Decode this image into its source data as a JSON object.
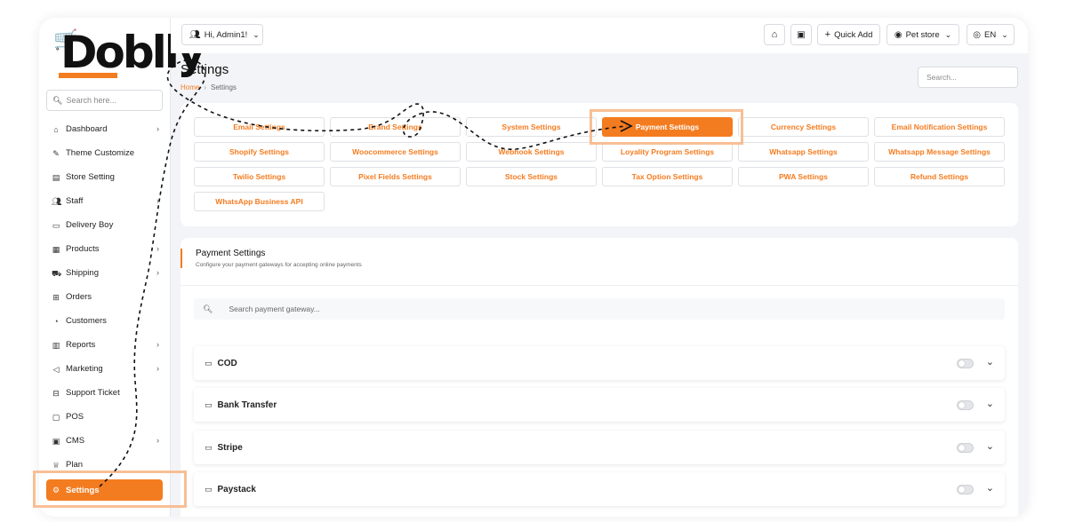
{
  "brand": {
    "name": "Doblly",
    "accent": "#f47c20"
  },
  "sidebar": {
    "search_placeholder": "Search here...",
    "items": [
      {
        "label": "Dashboard",
        "icon": "home-icon",
        "chevron": true
      },
      {
        "label": "Theme Customize",
        "icon": "brush-icon",
        "chevron": false
      },
      {
        "label": "Store Setting",
        "icon": "store-icon",
        "chevron": false
      },
      {
        "label": "Staff",
        "icon": "users-icon",
        "chevron": true
      },
      {
        "label": "Delivery Boy",
        "icon": "truck-icon",
        "chevron": false
      },
      {
        "label": "Products",
        "icon": "box-icon",
        "chevron": true
      },
      {
        "label": "Shipping",
        "icon": "shipping-icon",
        "chevron": true
      },
      {
        "label": "Orders",
        "icon": "cart-icon",
        "chevron": false
      },
      {
        "label": "Customers",
        "icon": "user-icon",
        "chevron": false
      },
      {
        "label": "Reports",
        "icon": "chart-icon",
        "chevron": true
      },
      {
        "label": "Marketing",
        "icon": "megaphone-icon",
        "chevron": true
      },
      {
        "label": "Support Ticket",
        "icon": "ticket-icon",
        "chevron": false
      },
      {
        "label": "POS",
        "icon": "pos-icon",
        "chevron": false
      },
      {
        "label": "CMS",
        "icon": "cms-icon",
        "chevron": true
      },
      {
        "label": "Plan",
        "icon": "trophy-icon",
        "chevron": false
      },
      {
        "label": "Settings",
        "icon": "gear-icon",
        "chevron": false,
        "active": true
      }
    ]
  },
  "topbar": {
    "greeting": "Hi, Admin1!",
    "quick_add": "Quick Add",
    "store": "Pet store",
    "language": "EN"
  },
  "header": {
    "title": "Settings",
    "breadcrumb_home": "Home",
    "breadcrumb_current": "Settings",
    "search_placeholder": "Search..."
  },
  "settings_tabs": [
    "Email Settings",
    "Brand Settings",
    "System Settings",
    "Payment Settings",
    "Currency Settings",
    "Email Notification Settings",
    "Shopify Settings",
    "Woocommerce Settings",
    "Webhook Settings",
    "Loyality Program Settings",
    "Whatsapp Settings",
    "Whatsapp Message Settings",
    "Twilio Settings",
    "Pixel Fields Settings",
    "Stock Settings",
    "Tax Option Settings",
    "PWA Settings",
    "Refund Settings",
    "WhatsApp Business API"
  ],
  "active_tab": "Payment Settings",
  "payment": {
    "title": "Payment Settings",
    "subtitle": "Configure your payment gateways for accepting online payments",
    "search_placeholder": "Search payment gateway...",
    "gateways": [
      {
        "name": "COD",
        "enabled": false
      },
      {
        "name": "Bank Transfer",
        "enabled": false
      },
      {
        "name": "Stripe",
        "enabled": false
      },
      {
        "name": "Paystack",
        "enabled": false
      }
    ]
  }
}
